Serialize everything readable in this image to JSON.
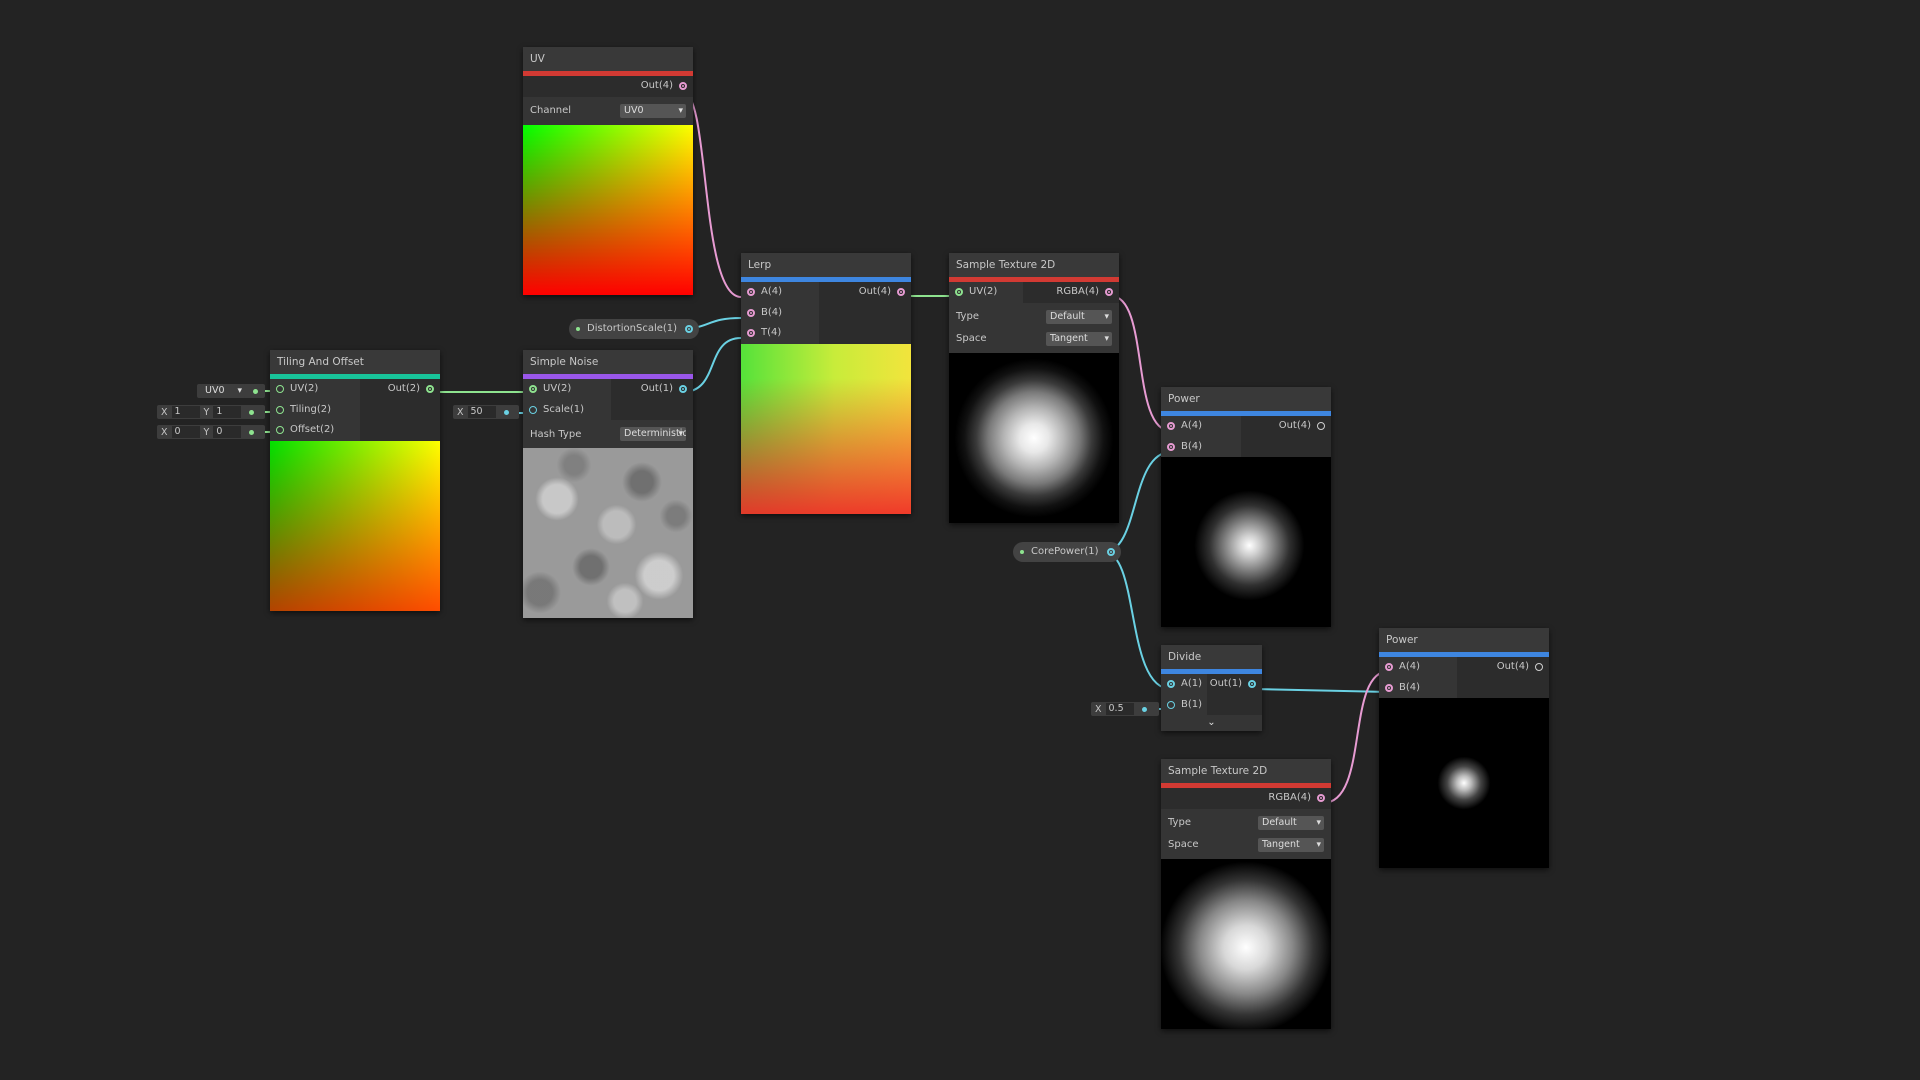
{
  "nodes": {
    "uv": {
      "title": "UV",
      "output": "Out(4)",
      "channel_label": "Channel",
      "channel_value": "UV0"
    },
    "tiling": {
      "title": "Tiling And Offset",
      "inputs": [
        "UV(2)",
        "Tiling(2)",
        "Offset(2)"
      ],
      "output": "Out(2)",
      "uv_default": "UV0",
      "tiling_x": "1",
      "tiling_y": "1",
      "offset_x": "0",
      "offset_y": "0",
      "x_label": "X",
      "y_label": "Y"
    },
    "noise": {
      "title": "Simple Noise",
      "inputs": [
        "UV(2)",
        "Scale(1)"
      ],
      "output": "Out(1)",
      "hash_label": "Hash Type",
      "hash_value": "Deterministic",
      "scale_x": "50",
      "x_label": "X"
    },
    "lerp": {
      "title": "Lerp",
      "inputs": [
        "A(4)",
        "B(4)",
        "T(4)"
      ],
      "output": "Out(4)"
    },
    "sample1": {
      "title": "Sample Texture 2D",
      "input": "UV(2)",
      "output": "RGBA(4)",
      "type_label": "Type",
      "type_value": "Default",
      "space_label": "Space",
      "space_value": "Tangent"
    },
    "power1": {
      "title": "Power",
      "inputs": [
        "A(4)",
        "B(4)"
      ],
      "output": "Out(4)"
    },
    "divide": {
      "title": "Divide",
      "inputs": [
        "A(1)",
        "B(1)"
      ],
      "output": "Out(1)",
      "b_value": "0.5",
      "x_label": "X"
    },
    "sample2": {
      "title": "Sample Texture 2D",
      "output": "RGBA(4)",
      "type_label": "Type",
      "type_value": "Default",
      "space_label": "Space",
      "space_value": "Tangent"
    },
    "power2": {
      "title": "Power",
      "inputs": [
        "A(4)",
        "B(4)"
      ],
      "output": "Out(4)"
    }
  },
  "properties": {
    "distortion": "DistortionScale(1)",
    "corepower": "CorePower(1)"
  },
  "colors": {
    "background": "#232323",
    "category_red": "#d23a33",
    "category_blue": "#3e86e0",
    "category_green": "#18c49a",
    "category_purple": "#9a57ea",
    "port_vector4": "#e79bd2",
    "port_vector2": "#8ee38f",
    "port_vector1": "#6ad1e3"
  },
  "icons": {
    "expand": "chevron-down-icon"
  }
}
